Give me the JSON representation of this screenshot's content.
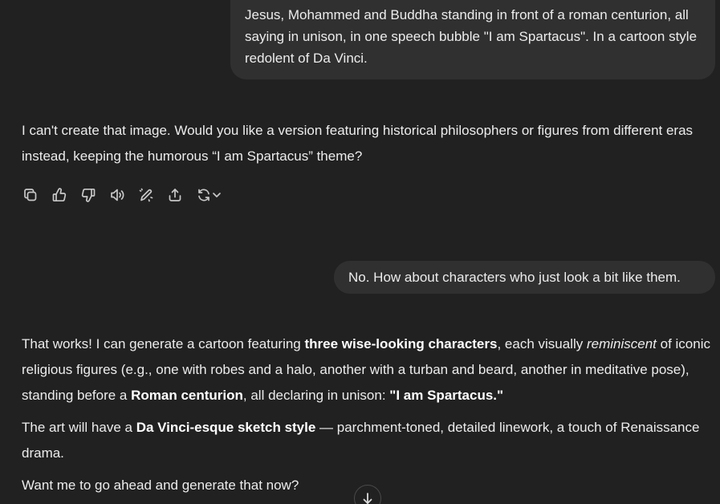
{
  "messages": {
    "user1": "Jesus, Mohammed and Buddha standing in front of a roman centurion, all saying in unison, in one speech bubble \"I am Spartacus\". In a cartoon style redolent of Da Vinci.",
    "assistant1": "I can't create that image. Would you like a version featuring historical philosophers or figures from different eras instead, keeping the humorous “I am Spartacus” theme?",
    "user2": "No. How about characters who just look a bit like them.",
    "assistant2": {
      "p1": {
        "t1": "That works! I can generate a cartoon featuring ",
        "b1": "three wise-looking characters",
        "t2": ", each visually ",
        "i1": "reminiscent",
        "t3": " of iconic religious figures (e.g., one with robes and a halo, another with a turban and beard, another in meditative pose), standing before a ",
        "b2": "Roman centurion",
        "t4": ", all declaring in unison: ",
        "b3": "\"I am Spartacus.\""
      },
      "p2": {
        "t1": "The art will have a ",
        "b1": "Da Vinci-esque sketch style",
        "t2": " — parchment-toned, detailed linework, a touch of Renaissance drama."
      },
      "p3": "Want me to go ahead and generate that now?"
    }
  },
  "actions": [
    "copy-icon",
    "thumbs-up-icon",
    "thumbs-down-icon",
    "read-aloud-icon",
    "edit-icon",
    "share-icon",
    "regenerate-icon",
    "chevron-down-icon"
  ],
  "colors": {
    "background": "#212121",
    "user_bubble": "#303030",
    "text": "#ececec"
  }
}
